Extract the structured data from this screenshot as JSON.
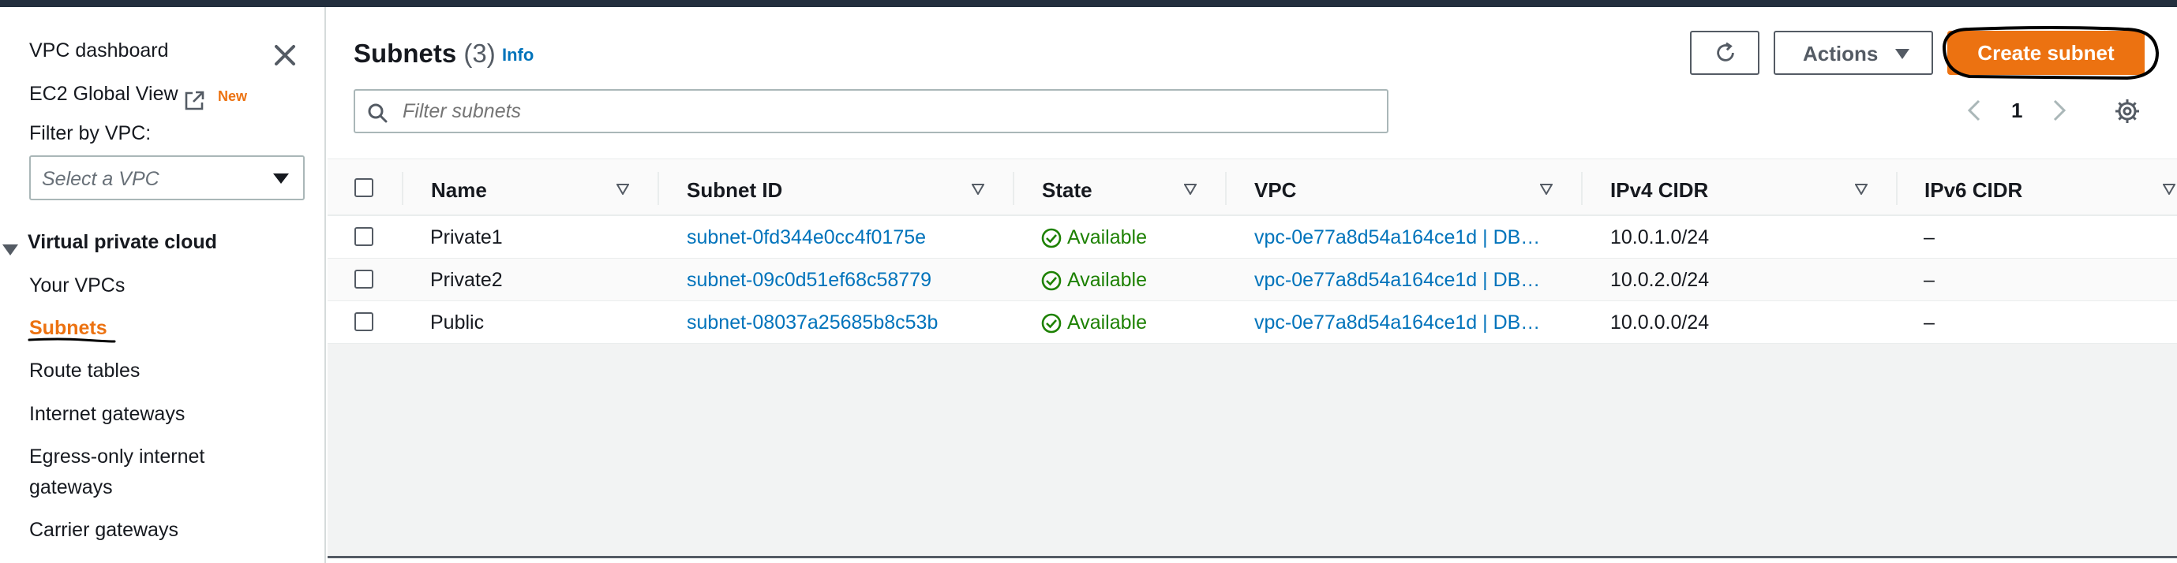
{
  "sidebar": {
    "vpc_dashboard": "VPC dashboard",
    "ec2_global_view": "EC2 Global View",
    "new_badge": "New",
    "filter_label": "Filter by VPC:",
    "vpc_select_placeholder": "Select a VPC",
    "section_title": "Virtual private cloud",
    "items": [
      {
        "label": "Your VPCs",
        "active": false
      },
      {
        "label": "Subnets",
        "active": true
      },
      {
        "label": "Route tables",
        "active": false
      },
      {
        "label": "Internet gateways",
        "active": false
      },
      {
        "label": "Egress-only internet",
        "active": false
      },
      {
        "label": "gateways",
        "active": false
      },
      {
        "label": "Carrier gateways",
        "active": false
      }
    ]
  },
  "header": {
    "title": "Subnets",
    "count": "(3)",
    "info": "Info",
    "actions_label": "Actions",
    "create_label": "Create subnet"
  },
  "filter": {
    "placeholder": "Filter subnets"
  },
  "pagination": {
    "current_page": "1"
  },
  "table": {
    "columns": [
      "Name",
      "Subnet ID",
      "State",
      "VPC",
      "IPv4 CIDR",
      "IPv6 CIDR"
    ],
    "rows": [
      {
        "name": "Private1",
        "subnet_id": "subnet-0fd344e0cc4f0175e",
        "state": "Available",
        "vpc": "vpc-0e77a8d54a164ce1d | DB…",
        "ipv4": "10.0.1.0/24",
        "ipv6": "–"
      },
      {
        "name": "Private2",
        "subnet_id": "subnet-09c0d51ef68c58779",
        "state": "Available",
        "vpc": "vpc-0e77a8d54a164ce1d | DB…",
        "ipv4": "10.0.2.0/24",
        "ipv6": "–"
      },
      {
        "name": "Public",
        "subnet_id": "subnet-08037a25685b8c53b",
        "state": "Available",
        "vpc": "vpc-0e77a8d54a164ce1d | DB…",
        "ipv4": "10.0.0.0/24",
        "ipv6": "–"
      }
    ]
  },
  "colors": {
    "accent": "#ec7211",
    "link": "#0073bb",
    "success": "#1d8102",
    "dark": "#232f3e"
  }
}
